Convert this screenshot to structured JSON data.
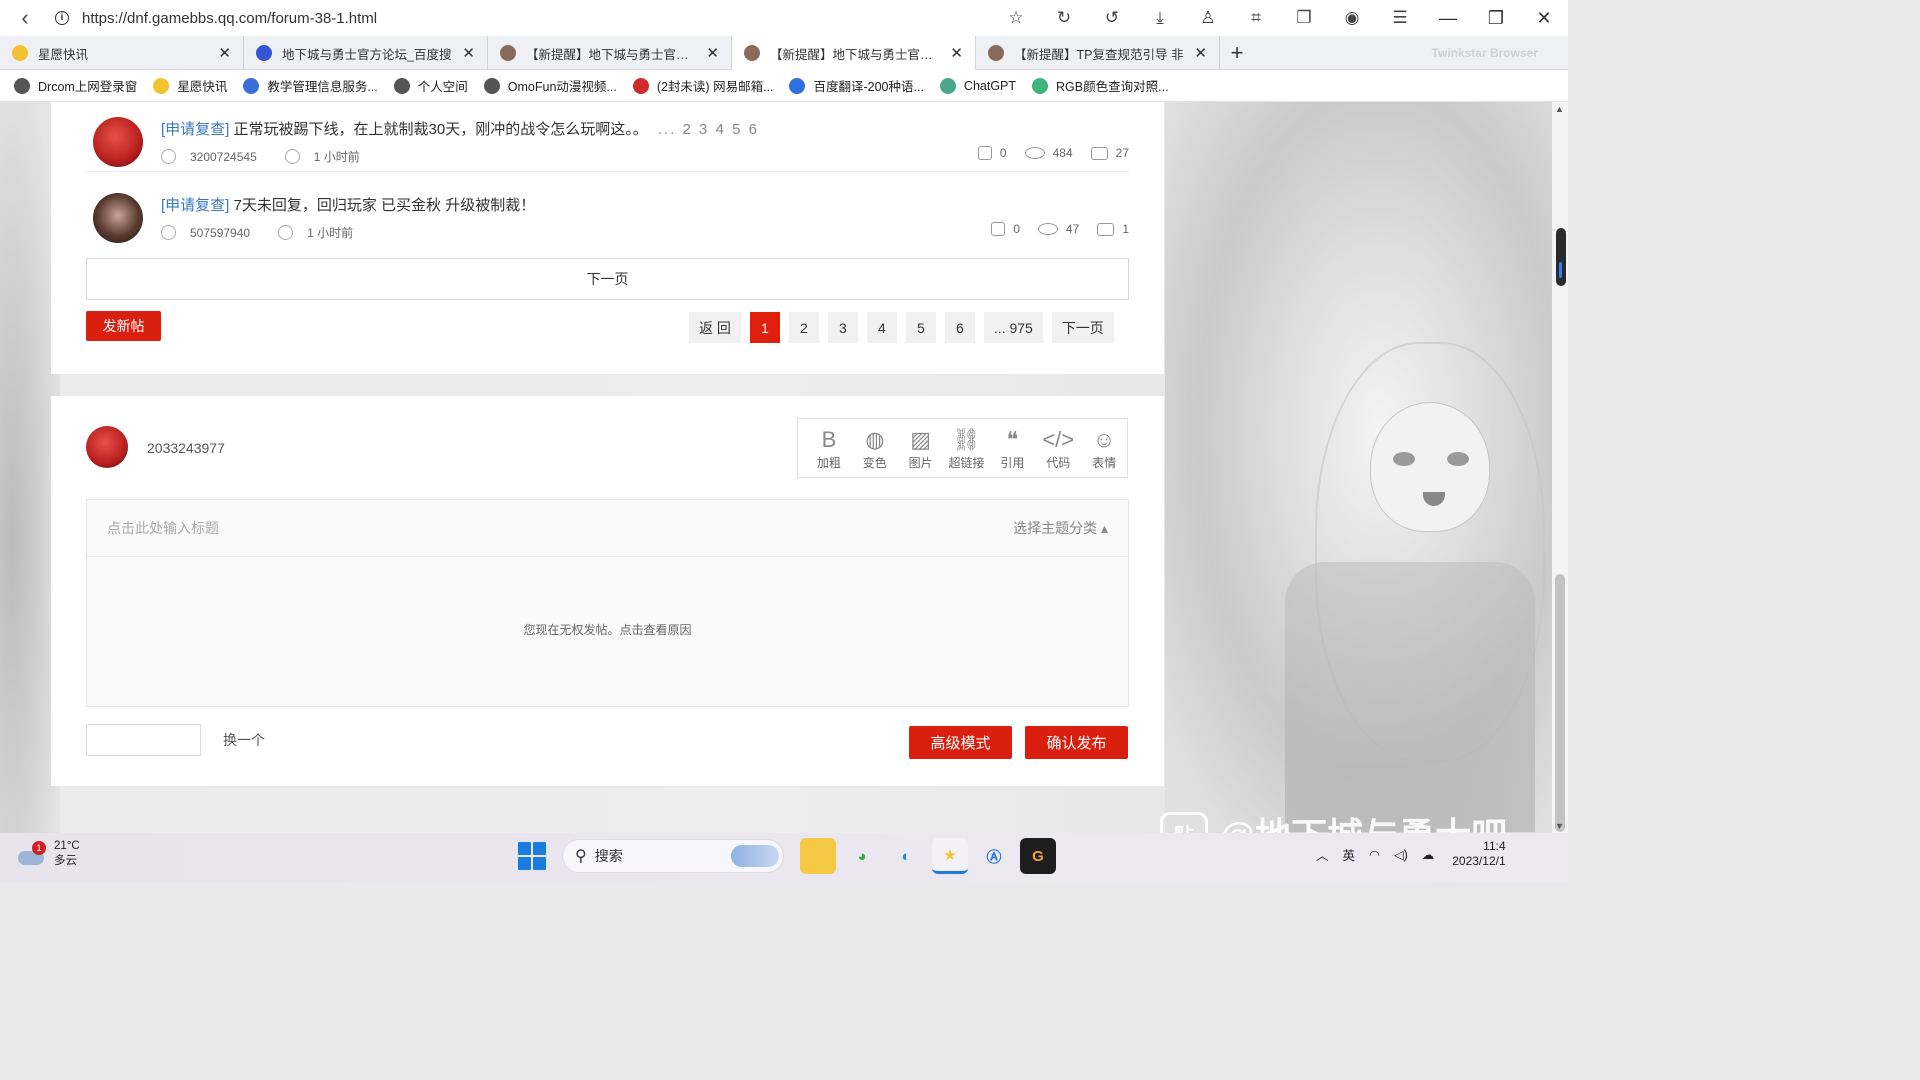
{
  "browser": {
    "url": "https://dnf.gamebbs.qq.com/forum-38-1.html",
    "tabs": [
      {
        "title": "星愿快讯",
        "fav_color": "#f2c230"
      },
      {
        "title": "地下城与勇士官方论坛_百度搜",
        "fav_color": "#3655d6"
      },
      {
        "title": "【新提醒】地下城与勇士官方论",
        "fav_color": "#8a6a5a"
      },
      {
        "title": "【新提醒】地下城与勇士官方论",
        "fav_color": "#8a6a5a"
      },
      {
        "title": "【新提醒】TP复查规范引导 非",
        "fav_color": "#8a6a5a"
      }
    ],
    "active_tab_index": 3,
    "brand": "Twinkstar Browser",
    "bookmarks": [
      {
        "label": "Drcom上网登录窗",
        "color": "#555555"
      },
      {
        "label": "星愿快讯",
        "color": "#f2c230"
      },
      {
        "label": "教学管理信息服务...",
        "color": "#3a6fd8"
      },
      {
        "label": "个人空间",
        "color": "#555555"
      },
      {
        "label": "OmoFun动漫视频...",
        "color": "#555555"
      },
      {
        "label": "(2封未读) 网易邮箱...",
        "color": "#d12a2a"
      },
      {
        "label": "百度翻译-200种语...",
        "color": "#2f6fe0"
      },
      {
        "label": "ChatGPT",
        "color": "#4aa88a"
      },
      {
        "label": "RGB颜色查询对照...",
        "color": "#3fb37c"
      }
    ]
  },
  "posts": [
    {
      "tag": "[申请复查]",
      "title": "正常玩被踢下线，在上就制裁30天，刚冲的战令怎么玩啊这。。",
      "pages": "... 2 3 4 5 6",
      "author": "3200724545",
      "time": "1 小时前",
      "likes": "0",
      "views": "484",
      "comments": "27",
      "avatar_color": "#b8201e"
    },
    {
      "tag": "[申请复查]",
      "title": "7天未回复，回归玩家 已买金秋 升级被制裁！",
      "pages": "",
      "author": "507597940",
      "time": "1 小时前",
      "likes": "0",
      "views": "47",
      "comments": "1",
      "avatar_color": "#5a3a30"
    }
  ],
  "pagination": {
    "next_page_bar": "下一页",
    "new_post": "发新帖",
    "back": "返 回",
    "pages": [
      "1",
      "2",
      "3",
      "4",
      "5",
      "6"
    ],
    "last": "... 975",
    "next": "下一页",
    "current": "1"
  },
  "composer": {
    "username": "2033243977",
    "tools": [
      {
        "icon": "bold-icon",
        "glyph": "B",
        "label": "加粗"
      },
      {
        "icon": "palette-icon",
        "glyph": "◍",
        "label": "变色"
      },
      {
        "icon": "image-icon",
        "glyph": "▨",
        "label": "图片"
      },
      {
        "icon": "link-icon",
        "glyph": "⛓",
        "label": "超链接"
      },
      {
        "icon": "quote-icon",
        "glyph": "❝",
        "label": "引用"
      },
      {
        "icon": "code-icon",
        "glyph": "</>",
        "label": "代码"
      },
      {
        "icon": "smiley-icon",
        "glyph": "☺",
        "label": "表情"
      }
    ],
    "title_placeholder": "点击此处输入标题",
    "category": "选择主题分类",
    "no_permission": "您现在无权发帖。点击查看原因",
    "refresh": "换一个",
    "advanced": "高级模式",
    "publish": "确认发布"
  },
  "watermark": "@地下城与勇士吧",
  "taskbar": {
    "weather_temp": "21°C",
    "weather_desc": "多云",
    "weather_badge": "1",
    "search_label": "搜索",
    "ime": "英",
    "time": "11:4",
    "date": "2023/12/1"
  }
}
